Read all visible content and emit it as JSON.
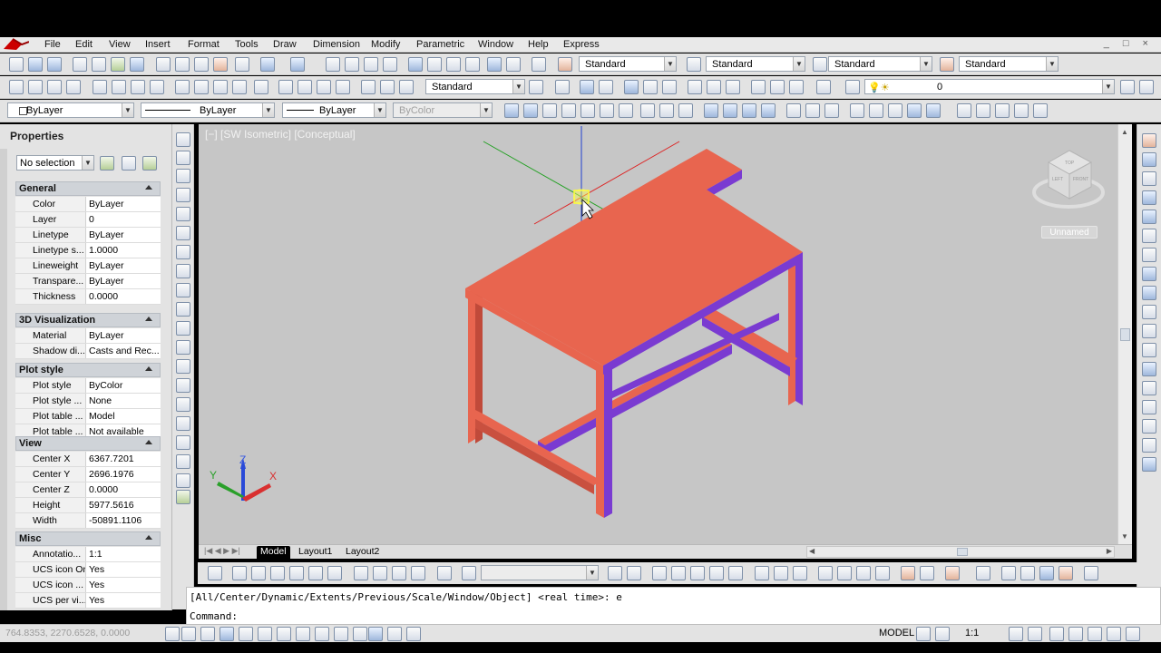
{
  "menu": [
    "File",
    "Edit",
    "View",
    "Insert",
    "Format",
    "Tools",
    "Draw",
    "Dimension",
    "Modify",
    "Parametric",
    "Window",
    "Help",
    "Express"
  ],
  "styles_toolbar": {
    "text_style": "Standard",
    "dim_style": "Standard",
    "table_style": "Standard",
    "multileader_style": "Standard"
  },
  "dim_toolbar": {
    "dim_style": "Standard"
  },
  "layer_toolbar": {
    "layer_value": "0"
  },
  "props_toolbar": {
    "color": "ByLayer",
    "linetype": "ByLayer",
    "lineweight": "ByLayer",
    "plotstyle": "ByColor"
  },
  "properties": {
    "title": "Properties",
    "selection": "No selection",
    "sections": [
      {
        "name": "General",
        "rows": [
          {
            "k": "Color",
            "v": "ByLayer"
          },
          {
            "k": "Layer",
            "v": "0"
          },
          {
            "k": "Linetype",
            "v": "ByLayer"
          },
          {
            "k": "Linetype s...",
            "v": "1.0000"
          },
          {
            "k": "Lineweight",
            "v": "ByLayer"
          },
          {
            "k": "Transpare...",
            "v": "ByLayer"
          },
          {
            "k": "Thickness",
            "v": "0.0000"
          }
        ]
      },
      {
        "name": "3D Visualization",
        "rows": [
          {
            "k": "Material",
            "v": "ByLayer"
          },
          {
            "k": "Shadow di...",
            "v": "Casts and Rec..."
          }
        ]
      },
      {
        "name": "Plot style",
        "rows": [
          {
            "k": "Plot style",
            "v": "ByColor"
          },
          {
            "k": "Plot style ...",
            "v": "None"
          },
          {
            "k": "Plot table ...",
            "v": "Model"
          },
          {
            "k": "Plot table ...",
            "v": "Not available"
          }
        ]
      },
      {
        "name": "View",
        "rows": [
          {
            "k": "Center X",
            "v": "6367.7201"
          },
          {
            "k": "Center Y",
            "v": "2696.1976"
          },
          {
            "k": "Center Z",
            "v": "0.0000"
          },
          {
            "k": "Height",
            "v": "5977.5616"
          },
          {
            "k": "Width",
            "v": "-50891.1106"
          }
        ]
      },
      {
        "name": "Misc",
        "rows": [
          {
            "k": "Annotatio...",
            "v": "1:1"
          },
          {
            "k": "UCS icon On",
            "v": "Yes"
          },
          {
            "k": "UCS icon ...",
            "v": "Yes"
          },
          {
            "k": "UCS per vi...",
            "v": "Yes"
          }
        ]
      }
    ]
  },
  "viewport": {
    "label": "[−] [SW Isometric] [Conceptual]",
    "viewcube_unnamed": "Unnamed",
    "viewcube_faces": {
      "top": "TOP",
      "left": "LEFT",
      "front": "FRONT"
    },
    "ucs": {
      "x": "X",
      "y": "Y",
      "z": "Z"
    },
    "table_color": "#e8654f",
    "table_side_color": "#7a3bd1"
  },
  "tabs": [
    "Model",
    "Layout1",
    "Layout2"
  ],
  "command": {
    "history": "[All/Center/Dynamic/Extents/Previous/Scale/Window/Object] <real time>: e",
    "prompt": "Command:"
  },
  "status": {
    "coords": "764.8353, 2270.6528, 0.0000",
    "model": "MODEL",
    "annoscale": "1:1"
  }
}
